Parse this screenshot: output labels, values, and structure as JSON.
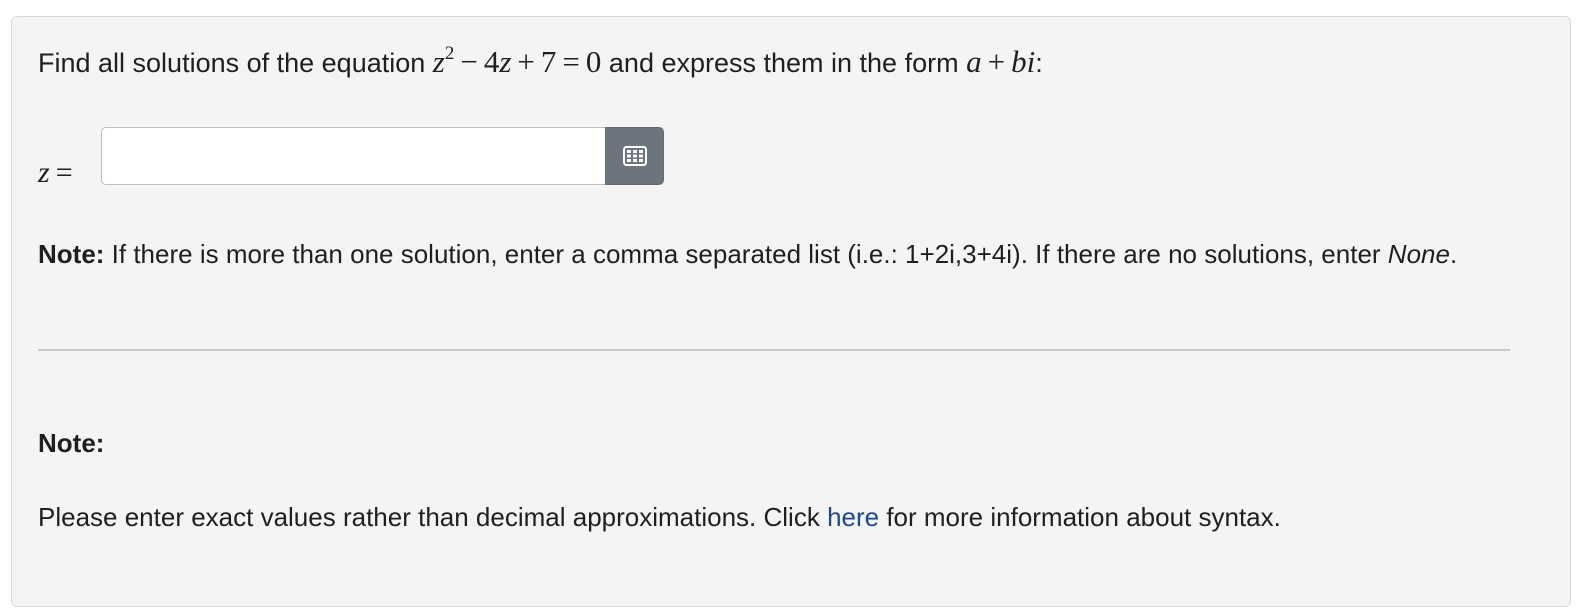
{
  "question": {
    "prefix": "Find all solutions of the equation",
    "equation": {
      "var": "z",
      "exponent": "2",
      "minus": "−",
      "coef_term": "4",
      "coef_var": "z",
      "plus": "+",
      "constant": "7",
      "equals": "=",
      "rhs": "0"
    },
    "middle": "and express them in the form",
    "form": {
      "a": "a",
      "plus": "+",
      "b": "b",
      "i": "i"
    },
    "suffix": ":"
  },
  "answer": {
    "label": "z",
    "equals": "=",
    "value": "",
    "placeholder": "",
    "keypad_icon": "keypad-grid-icon"
  },
  "note1": {
    "label": "Note:",
    "text": " If there is more than one solution, enter a comma separated list (i.e.: 1+2i,3+4i). If there are no solutions, enter ",
    "none_word": "None",
    "end": "."
  },
  "note2": {
    "title": "Note:",
    "text_before": "Please enter exact values rather than decimal approximations. Click ",
    "link_text": "here",
    "text_after": " for more information about syntax."
  },
  "colors": {
    "card_background": "#f4f4f4",
    "keypad_button": "#6c757d",
    "link": "#1c4a8a"
  }
}
